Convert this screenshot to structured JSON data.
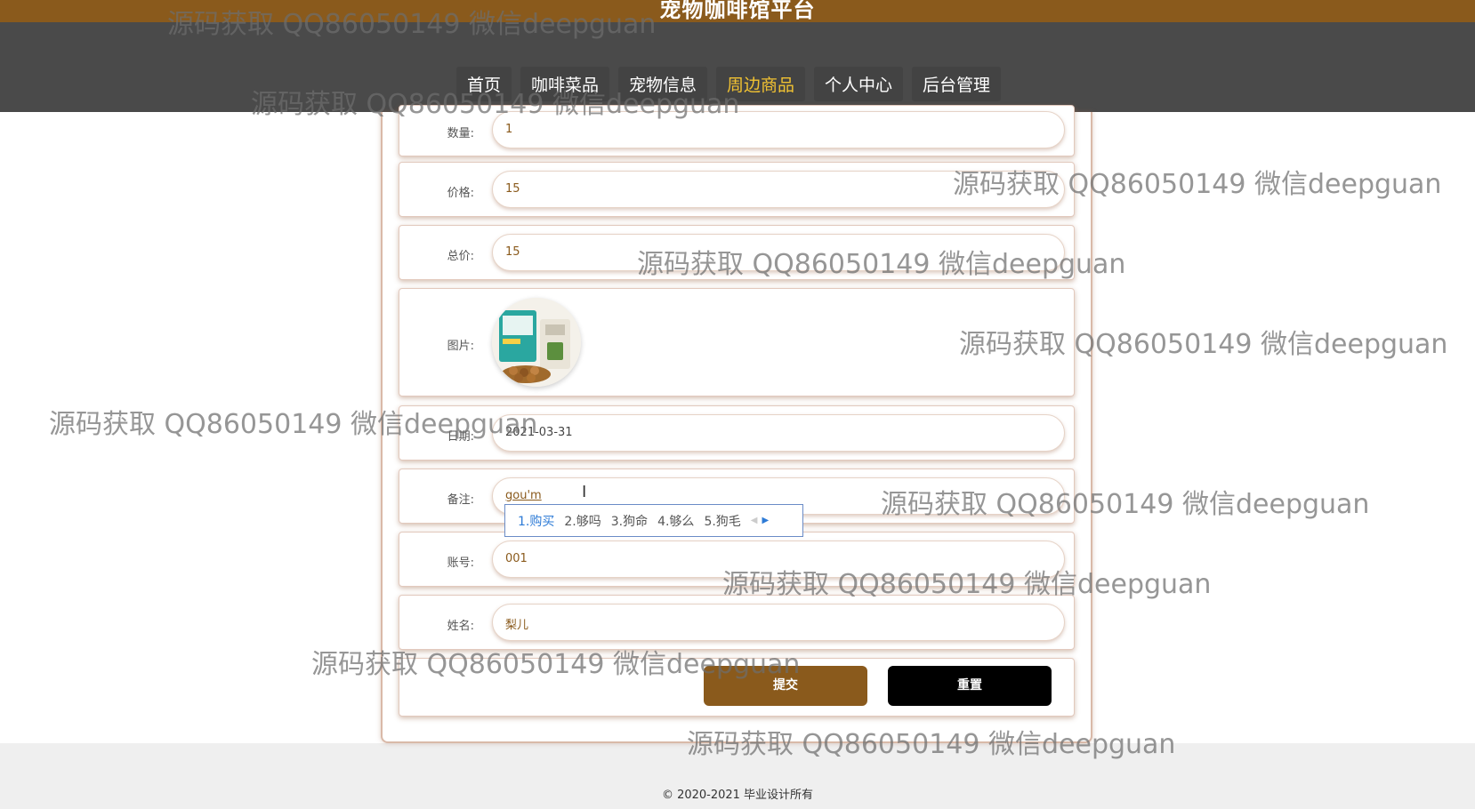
{
  "header": {
    "site_title": "宠物咖啡馆平台",
    "nav": [
      {
        "label": "首页",
        "active": false
      },
      {
        "label": "咖啡菜品",
        "active": false
      },
      {
        "label": "宠物信息",
        "active": false
      },
      {
        "label": "周边商品",
        "active": true
      },
      {
        "label": "个人中心",
        "active": false
      },
      {
        "label": "后台管理",
        "active": false
      }
    ]
  },
  "form": {
    "quantity": {
      "label": "数量:",
      "value": "1"
    },
    "price": {
      "label": "价格:",
      "value": "15"
    },
    "total": {
      "label": "总价:",
      "value": "15"
    },
    "image": {
      "label": "图片:"
    },
    "date": {
      "label": "日期:",
      "value": "2021-03-31"
    },
    "remark": {
      "label": "备注:",
      "value": "gou'm"
    },
    "account": {
      "label": "账号:",
      "value": "001"
    },
    "name": {
      "label": "姓名:",
      "value": "梨儿"
    },
    "submit_label": "提交",
    "reset_label": "重置"
  },
  "ime": {
    "candidates": [
      "1.购买",
      "2.够吗",
      "3.狗命",
      "4.够么",
      "5.狗毛"
    ]
  },
  "footer": {
    "text": "© 2020-2021 毕业设计所有"
  },
  "watermark": "源码获取 QQ86050149 微信deepguan",
  "colors": {
    "brand": "#8a5a1c",
    "nav_bg": "#4a4a4a",
    "nav_active": "#f1c232",
    "reset_button": "#000000"
  }
}
